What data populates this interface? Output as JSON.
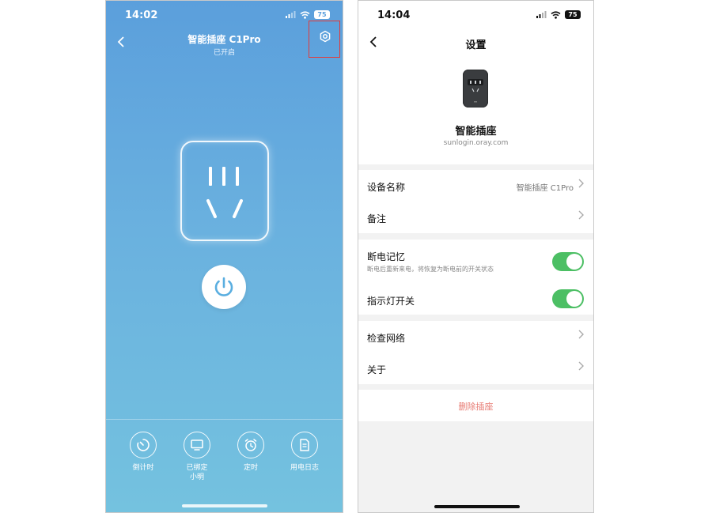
{
  "left_screen": {
    "status_time": "14:02",
    "battery": "75",
    "title": "智能插座 C1Pro",
    "subtitle": "已开启",
    "actions": [
      {
        "label": "倒计时",
        "icon": "countdown-icon"
      },
      {
        "label": "已绑定\n小明",
        "icon": "monitor-icon"
      },
      {
        "label": "定时",
        "icon": "alarm-clock-icon"
      },
      {
        "label": "用电日志",
        "icon": "document-icon"
      }
    ],
    "colors": {
      "gradient_top": "#5b9fdc",
      "gradient_bottom": "#74c2df",
      "power_icon": "#5aaee0",
      "highlight_box": "#e23a3a"
    }
  },
  "right_screen": {
    "status_time": "14:04",
    "battery": "75",
    "title": "设置",
    "device_name": "智能插座",
    "device_url": "sunlogin.oray.com",
    "rows": {
      "device_name_label": "设备名称",
      "device_name_value": "智能插座 C1Pro",
      "note_label": "备注",
      "power_memory_label": "断电记忆",
      "power_memory_desc": "断电后重新来电，将恢复为断电前的开关状态",
      "power_memory_on": true,
      "indicator_label": "指示灯开关",
      "indicator_on": true,
      "check_network_label": "检查网络",
      "about_label": "关于"
    },
    "delete_label": "删除插座",
    "colors": {
      "toggle_on": "#4cbf64",
      "delete_text": "#e77a72"
    }
  }
}
